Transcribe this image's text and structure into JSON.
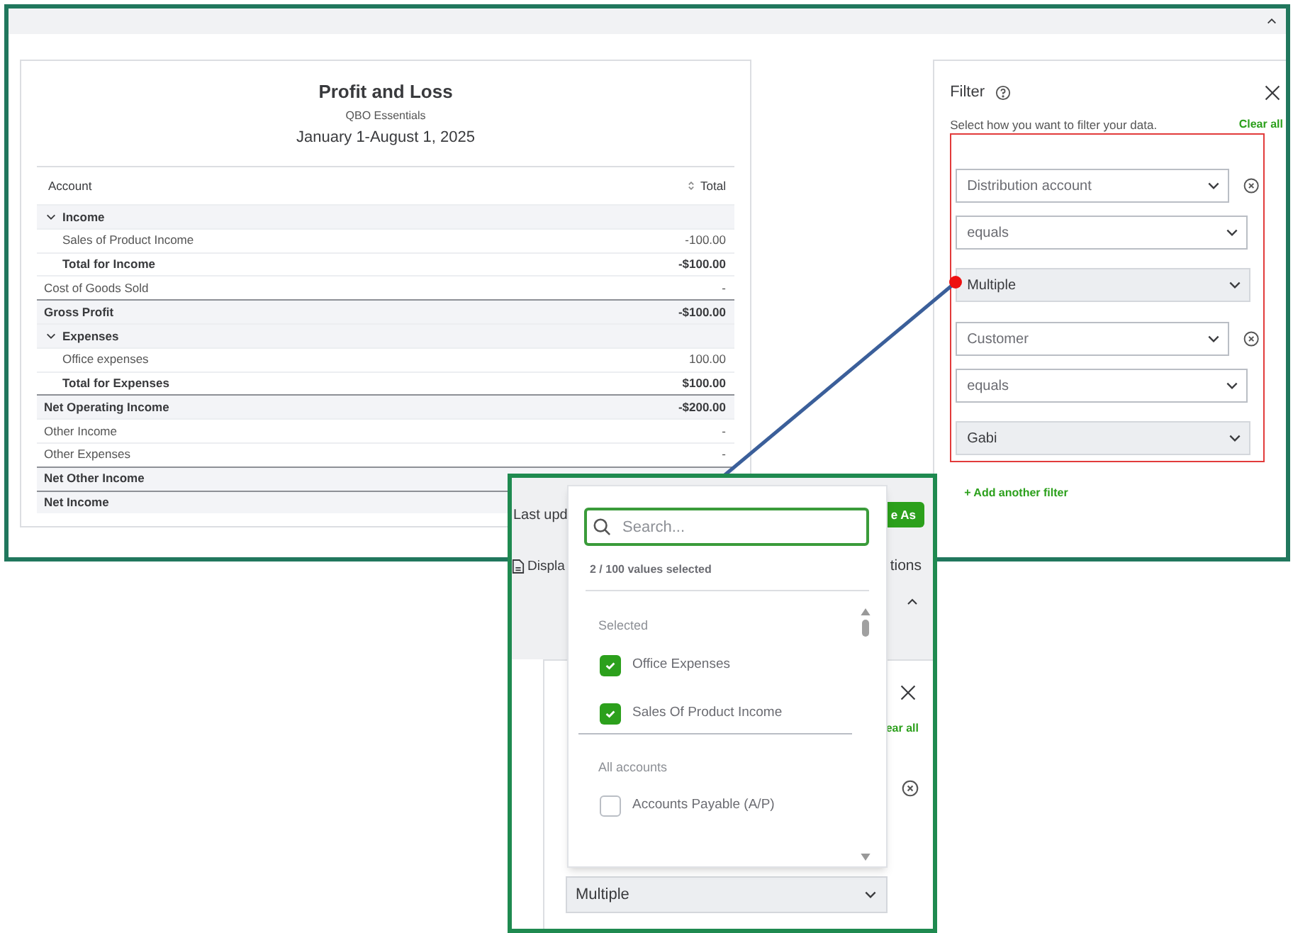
{
  "report": {
    "title": "Profit and Loss",
    "company": "QBO Essentials",
    "period": "January 1-August 1, 2025",
    "columns": [
      "Account",
      "Total"
    ],
    "rows": [
      {
        "kind": "section",
        "label": "Income",
        "expanded": true
      },
      {
        "kind": "item",
        "label": "Sales of Product Income",
        "value": "-100.00"
      },
      {
        "kind": "total",
        "label": "Total for Income",
        "value": "-$100.00"
      },
      {
        "kind": "plain",
        "label": "Cost of Goods Sold",
        "value": "-"
      },
      {
        "kind": "summary",
        "label": "Gross Profit",
        "value": "-$100.00"
      },
      {
        "kind": "section",
        "label": "Expenses",
        "expanded": true
      },
      {
        "kind": "item",
        "label": "Office expenses",
        "value": "100.00"
      },
      {
        "kind": "total",
        "label": "Total for Expenses",
        "value": "$100.00"
      },
      {
        "kind": "summary",
        "label": "Net Operating Income",
        "value": "-$200.00"
      },
      {
        "kind": "plain",
        "label": "Other Income",
        "value": "-"
      },
      {
        "kind": "plain",
        "label": "Other Expenses",
        "value": "-"
      },
      {
        "kind": "summary",
        "label": "Net Other Income"
      },
      {
        "kind": "summary",
        "label": "Net Income"
      }
    ]
  },
  "filter": {
    "title": "Filter",
    "description": "Select how you want to filter your data.",
    "clear_all": "Clear all",
    "filters": [
      {
        "fields": [
          {
            "kind": "select",
            "value": "Distribution account"
          },
          {
            "kind": "select",
            "value": "equals"
          },
          {
            "kind": "value",
            "value": "Multiple"
          }
        ]
      },
      {
        "fields": [
          {
            "kind": "select",
            "value": "Customer"
          },
          {
            "kind": "select",
            "value": "equals"
          },
          {
            "kind": "value",
            "value": "Gabi"
          }
        ]
      }
    ],
    "add_filter": "+ Add another filter"
  },
  "inset": {
    "last_updated": "Last upd",
    "save_button": "e As",
    "display": "Displa",
    "options": "tions",
    "clear_all": "ear all",
    "value_field": "Multiple",
    "dropdown": {
      "placeholder": "Search...",
      "count": "2 / 100 values selected",
      "groups": [
        {
          "label": "Selected",
          "options": [
            {
              "label": "Office Expenses",
              "checked": true
            },
            {
              "label": "Sales Of Product Income",
              "checked": true
            }
          ]
        },
        {
          "label": "All accounts",
          "options": [
            {
              "label": "Accounts Payable (A/P)",
              "checked": false
            }
          ]
        }
      ]
    }
  }
}
